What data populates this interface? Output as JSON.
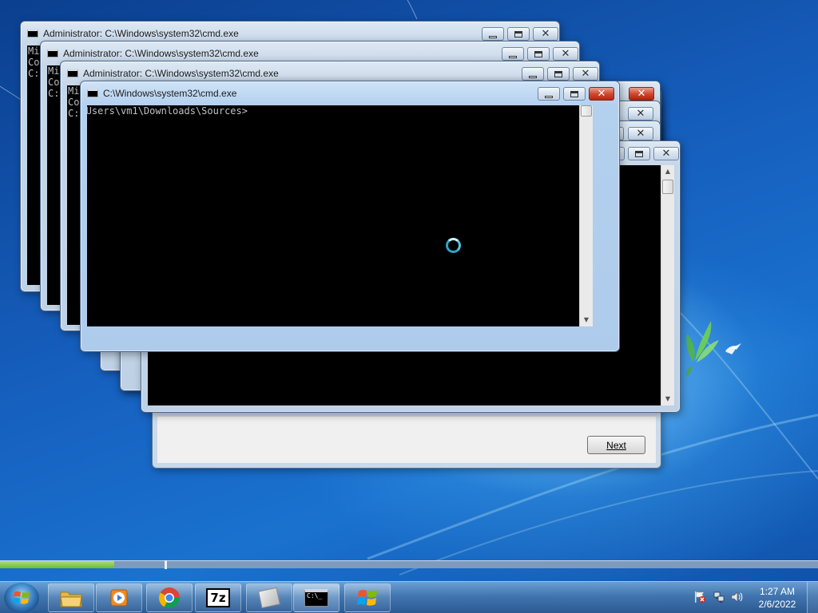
{
  "desktop": {
    "progress_fraction": 0.14
  },
  "setup_dialog": {
    "next_label": "Next"
  },
  "windows": [
    {
      "title": "Administrator: C:\\Windows\\system32\\cmd.exe",
      "lines": [
        "Mi",
        "Co",
        "",
        "C:"
      ]
    },
    {
      "title": "Administrator: C:\\Windows\\system32\\cmd.exe",
      "lines": [
        "Mi",
        "Co",
        "",
        "C:"
      ]
    },
    {
      "title": "Administrator: C:\\Windows\\system32\\cmd.exe",
      "lines": [
        "Mi",
        "Co",
        "",
        "C:"
      ]
    },
    {
      "title": "C:\\Windows\\system32\\cmd.exe",
      "lines": [
        "",
        "C:\\Users\\vm1\\Downloads\\Sources>"
      ]
    }
  ],
  "taskbar": {
    "buttons": [
      {
        "name": "windows-explorer",
        "icon": "folder-icon"
      },
      {
        "name": "media-player",
        "icon": "media-player-icon"
      },
      {
        "name": "google-chrome",
        "icon": "chrome-icon"
      },
      {
        "name": "7-zip",
        "icon": "7zip-icon",
        "label": "7z"
      },
      {
        "name": "blank-app",
        "icon": "generic-app-icon"
      },
      {
        "name": "command-prompt",
        "icon": "cmd-icon",
        "label": "C:\\_"
      },
      {
        "name": "windows-setup",
        "icon": "windows-flag-icon"
      }
    ],
    "clock_time": "1:27 AM",
    "clock_date": "2/6/2022",
    "tray_icons": [
      "action-center-flag-icon",
      "network-icon",
      "volume-icon"
    ]
  },
  "colors": {
    "desktop_blue": "#1660bf",
    "console_bg": "#000000",
    "console_fg": "#c0c0c0",
    "close_red": "#cf4a31",
    "spinner": "#2aa6c9",
    "progress_green": "#6dbb2f"
  }
}
